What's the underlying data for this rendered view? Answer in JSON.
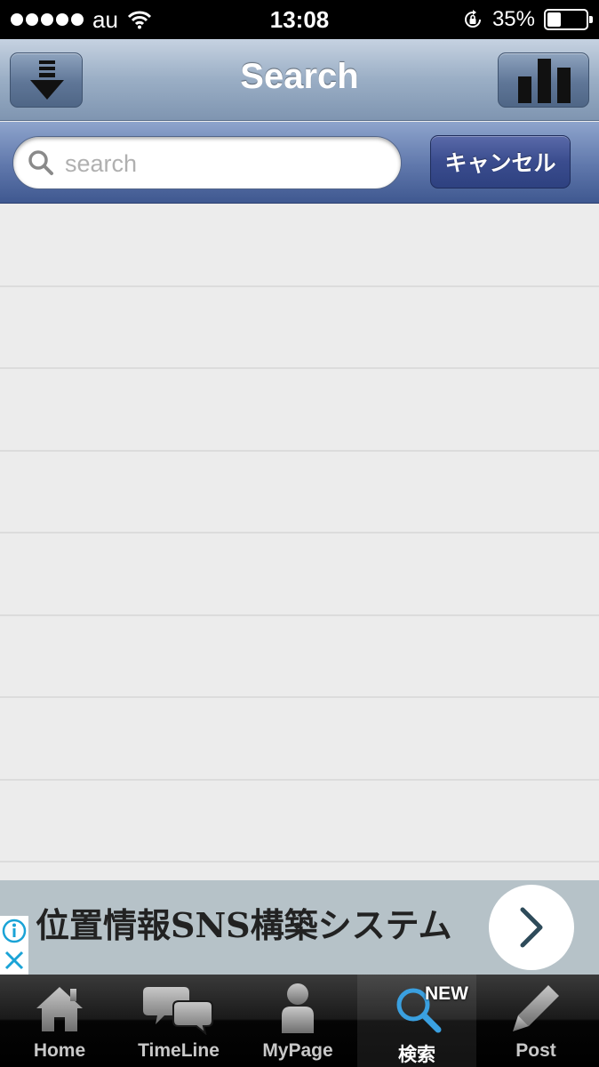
{
  "status_bar": {
    "carrier": "au",
    "time": "13:08",
    "battery": "35%",
    "battery_level": 0.35
  },
  "nav": {
    "title": "Search",
    "left_icon": "download-arrow-icon",
    "right_icon": "bar-chart-icon"
  },
  "search": {
    "placeholder": "search",
    "value": "",
    "cancel_label": "キャンセル"
  },
  "results": {
    "rows": 8
  },
  "ad": {
    "text": "位置情報SNS構築システム"
  },
  "tabs": [
    {
      "label": "Home",
      "icon": "home-icon"
    },
    {
      "label": "TimeLine",
      "icon": "speech-bubbles-icon"
    },
    {
      "label": "MyPage",
      "icon": "person-icon"
    },
    {
      "label": "検索",
      "icon": "magnifier-icon",
      "badge": "NEW",
      "active": true
    },
    {
      "label": "Post",
      "icon": "pencil-icon"
    }
  ],
  "colors": {
    "navbar": "#9aaec5",
    "searchbar": "#5f77ab",
    "cancel": "#3a4c8e",
    "active_icon": "#3aa0e0"
  }
}
